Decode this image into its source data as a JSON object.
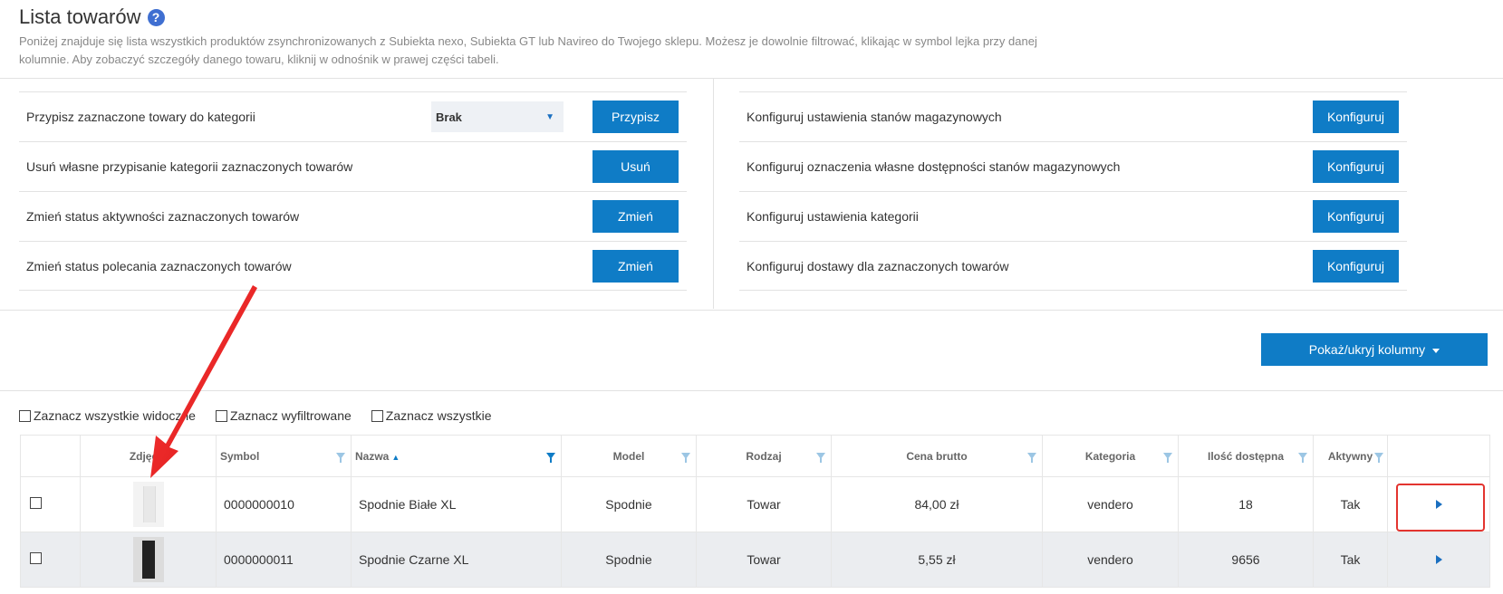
{
  "header": {
    "title": "Lista towarów",
    "help_icon": "?",
    "description": "Poniżej znajduje się lista wszystkich produktów zsynchronizowanych z Subiekta nexo, Subiekta GT lub Navireo do Twojego sklepu. Możesz je dowolnie filtrować, klikając w symbol lejka przy danej kolumnie. Aby zobaczyć szczegóły danego towaru, kliknij w odnośnik w prawej części tabeli."
  },
  "left_actions": [
    {
      "label": "Przypisz zaznaczone towary do kategorii",
      "select_value": "Brak",
      "button": "Przypisz"
    },
    {
      "label": "Usuń własne przypisanie kategorii zaznaczonych towarów",
      "button": "Usuń"
    },
    {
      "label": "Zmień status aktywności zaznaczonych towarów",
      "button": "Zmień"
    },
    {
      "label": "Zmień status polecania zaznaczonych towarów",
      "button": "Zmień"
    }
  ],
  "right_actions": [
    {
      "label": "Konfiguruj ustawienia stanów magazynowych",
      "button": "Konfiguruj"
    },
    {
      "label": "Konfiguruj oznaczenia własne dostępności stanów magazynowych",
      "button": "Konfiguruj"
    },
    {
      "label": "Konfiguruj ustawienia kategorii",
      "button": "Konfiguruj"
    },
    {
      "label": "Konfiguruj dostawy dla zaznaczonych towarów",
      "button": "Konfiguruj"
    }
  ],
  "columns_button": "Pokaż/ukryj kolumny",
  "select_options": [
    "Zaznacz wszystkie widoczne",
    "Zaznacz wyfiltrowane",
    "Zaznacz wszystkie"
  ],
  "table": {
    "headers": [
      "Zdjęcie",
      "Symbol",
      "Nazwa",
      "Model",
      "Rodzaj",
      "Cena brutto",
      "Kategoria",
      "Ilość dostępna",
      "Aktywny"
    ],
    "rows": [
      {
        "symbol": "0000000010",
        "name": "Spodnie Białe XL",
        "model": "Spodnie",
        "type": "Towar",
        "price": "84,00 zł",
        "category": "vendero",
        "qty": "18",
        "active": "Tak"
      },
      {
        "symbol": "0000000011",
        "name": "Spodnie Czarne XL",
        "model": "Spodnie",
        "type": "Towar",
        "price": "5,55 zł",
        "category": "vendero",
        "qty": "9656",
        "active": "Tak"
      }
    ]
  },
  "colors": {
    "primary": "#0f7cc6",
    "annotation": "#e3342f"
  }
}
